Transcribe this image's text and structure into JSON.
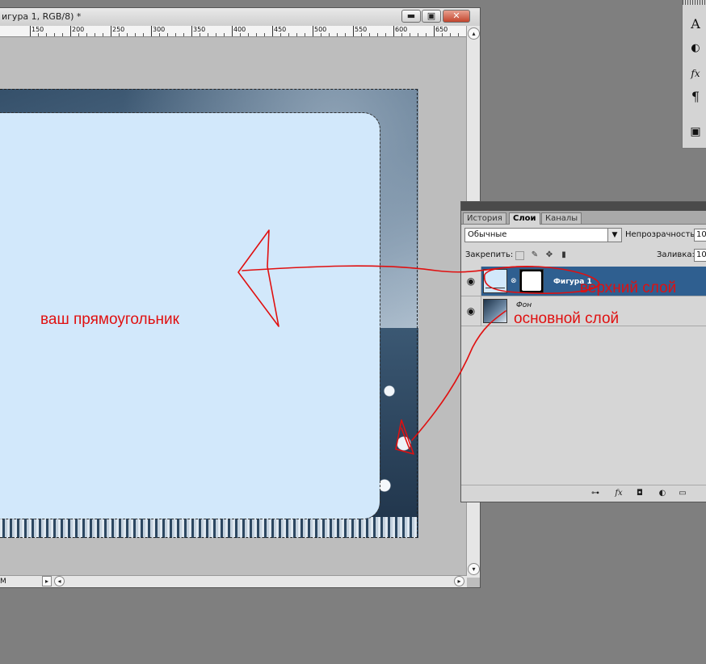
{
  "document": {
    "title": "игура 1, RGB/8) *",
    "window_buttons": {
      "minimize": "▬",
      "restore": "▣",
      "close": "✕"
    },
    "ruler_ticks": [
      "150",
      "200",
      "250",
      "300",
      "350",
      "400",
      "450",
      "500",
      "550",
      "600",
      "650"
    ],
    "status_zoom": "M",
    "scroll_left_arrow": "◂",
    "scroll_right_arrow": "▸",
    "scroll_up_arrow": "▴",
    "scroll_down_arrow": "▾"
  },
  "tools": {
    "type_tool": "A",
    "brush_tool": "◐",
    "fx_tool": "fx",
    "paragraph_tool": "¶",
    "square_tool": "▣"
  },
  "layers_panel": {
    "tabs": [
      "История",
      "Слои",
      "Каналы"
    ],
    "active_tab": "Слои",
    "blend_mode": "Обычные",
    "opacity_label": "Непрозрачность:",
    "opacity_value": "10",
    "lock_label": "Закрепить:",
    "fill_label": "Заливка:",
    "fill_value": "10",
    "layers": [
      {
        "name": "Фигура 1",
        "visible": true,
        "selected": true
      },
      {
        "name": "Фон",
        "visible": true,
        "selected": false
      }
    ],
    "footer_icons": [
      "link-icon",
      "fx-icon",
      "mask-icon",
      "adjustment-icon",
      "group-icon"
    ],
    "footer_glyphs": [
      "⊶",
      "fx",
      "◘",
      "◐",
      "▭"
    ]
  },
  "annotations": {
    "rectangle_label": "ваш прямоугольник",
    "top_layer_label": "верхний слой",
    "base_layer_label": "основной слой",
    "color": "#e01010"
  },
  "colors": {
    "shape_fill": "#d2e8fb",
    "selected_layer": "#2f5f90",
    "workspace": "#7f7f7f"
  }
}
